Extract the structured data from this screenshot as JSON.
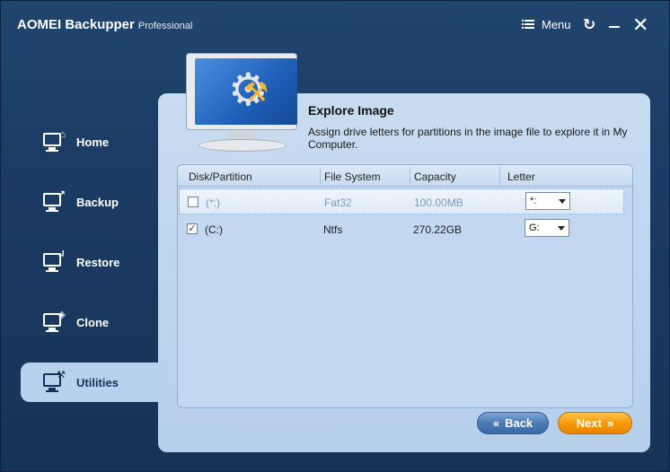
{
  "window": {
    "app_title": "AOMEI Backupper",
    "edition": "Professional",
    "menu_label": "Menu"
  },
  "sidebar": {
    "items": [
      {
        "label": "Home",
        "icon": "home-icon"
      },
      {
        "label": "Backup",
        "icon": "backup-icon"
      },
      {
        "label": "Restore",
        "icon": "restore-icon"
      },
      {
        "label": "Clone",
        "icon": "clone-icon"
      },
      {
        "label": "Utilities",
        "icon": "utilities-icon",
        "active": true
      }
    ]
  },
  "main": {
    "title": "Explore Image",
    "description": "Assign drive letters for partitions in the image file to explore it in My Computer.",
    "table": {
      "columns": [
        "Disk/Partition",
        "File System",
        "Capacity",
        "Letter"
      ],
      "rows": [
        {
          "checked": false,
          "partition": "(*:)",
          "file_system": "Fat32",
          "capacity": "100.00MB",
          "letter": "*:"
        },
        {
          "checked": true,
          "partition": "(C:)",
          "file_system": "Ntfs",
          "capacity": "270.22GB",
          "letter": "G:"
        }
      ]
    }
  },
  "footer": {
    "back_label": "Back",
    "next_label": "Next"
  },
  "colors": {
    "window_bg": "#1a3b63",
    "panel_bg": "#c8dcf1",
    "back_button": "#4c7bb4",
    "next_button": "#f59a0b"
  }
}
